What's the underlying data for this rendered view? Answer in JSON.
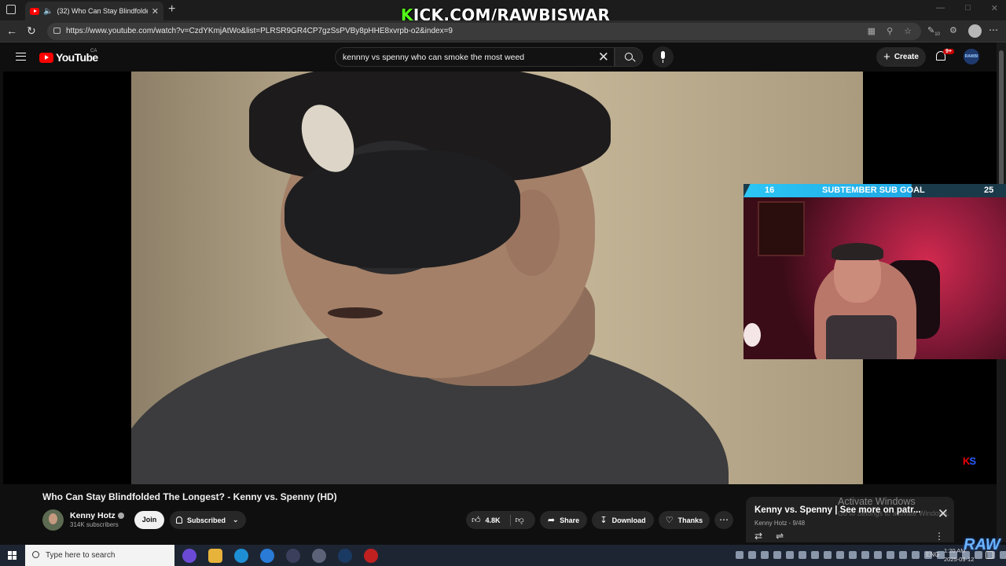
{
  "browser": {
    "tab_title": "(32) Who Can Stay Blindfolded",
    "url": "https://www.youtube.com/watch?v=CzdYKmjAtWo&list=PLRSR9GR4CP7gzSsPVBy8pHHE8xvrpb-o2&index=9",
    "extension_count": "10"
  },
  "stream_overlay": {
    "kick_prefix": "K",
    "kick_rest": "ICK.COM/RAWBISWAR",
    "goal_current": 16,
    "goal_title": "SUBTEMBER SUB GOAL",
    "goal_target": 25,
    "logo_text": "RAW"
  },
  "youtube": {
    "logo": "YouTube",
    "country_code": "CA",
    "search_query": "kennny vs spenny who can smoke the most weed",
    "create_label": "Create",
    "notification_badge": "9+",
    "avatar_text": "RAWBI"
  },
  "video": {
    "title": "Who Can Stay Blindfolded The Longest? - Kenny vs. Spenny (HD)",
    "watermark_k": "K",
    "watermark_s": "S",
    "channel": {
      "name": "Kenny Hotz",
      "subscribers": "314K subscribers",
      "join_label": "Join",
      "subscribed_label": "Subscribed"
    },
    "actions": {
      "likes": "4.8K",
      "share": "Share",
      "download": "Download",
      "thanks": "Thanks"
    }
  },
  "playlist": {
    "title": "Kenny vs. Spenny | See more on patr...",
    "owner": "Kenny Hotz",
    "position": "9/48"
  },
  "windows_watermark": {
    "line1": "Activate Windows",
    "line2": "Go to Settings to activate Windows."
  },
  "taskbar": {
    "search_placeholder": "Type here to search",
    "language": "ENG",
    "time": "1:20 AM",
    "date": "2025-09-12"
  },
  "colors": {
    "youtube_red": "#ff0000",
    "kick_green": "#53fc18",
    "goal_blue": "#2cc6f5"
  }
}
